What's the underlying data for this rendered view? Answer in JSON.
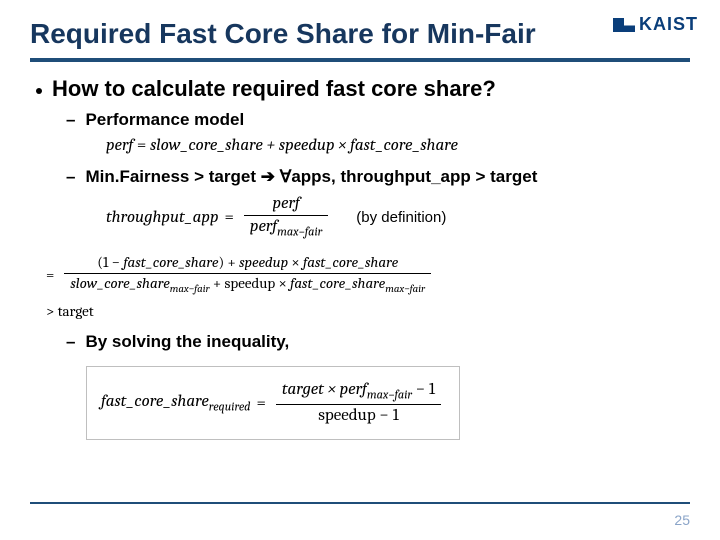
{
  "header": {
    "title": "Required Fast Core Share for Min-Fair",
    "logo_text": "KAIST"
  },
  "content": {
    "main_bullet": "How to calculate required fast core share?",
    "sub1": "Performance model",
    "eq1_lhs": "perf",
    "eq1_eq": " = ",
    "eq1_rhs": "slow_core_share + speedup × fast_core_share",
    "sub2_prefix": "Min.Fairness > target ",
    "sub2_arrow": "➔",
    "sub2_suffix": " ∀apps, throughput_app > target",
    "eq2_lhs": "throughput_app",
    "eq2_eq": " = ",
    "eq2_num": "perf",
    "eq2_den_a": "perf",
    "eq2_den_sub": "max−fair",
    "note": "(by definition)",
    "eq3_eq": "= ",
    "eq3_num": "(1 − fast_core_share) + speedup × fast_core_share",
    "eq3_den_a": "slow_core_share",
    "eq3_den_sub1": "max−fair",
    "eq3_den_plus": " + speedup × ",
    "eq3_den_b": "fast_core_share",
    "eq3_den_sub2": "max−fair",
    "eq4": "> target",
    "sub3": "By solving the inequality,",
    "eq5_lhs_a": "fast_core_share",
    "eq5_lhs_sub": "required",
    "eq5_eq": " = ",
    "eq5_num_a": "target × perf",
    "eq5_num_sub": "max−fair",
    "eq5_num_tail": " − 1",
    "eq5_den": "speedup − 1"
  },
  "page_number": "25"
}
